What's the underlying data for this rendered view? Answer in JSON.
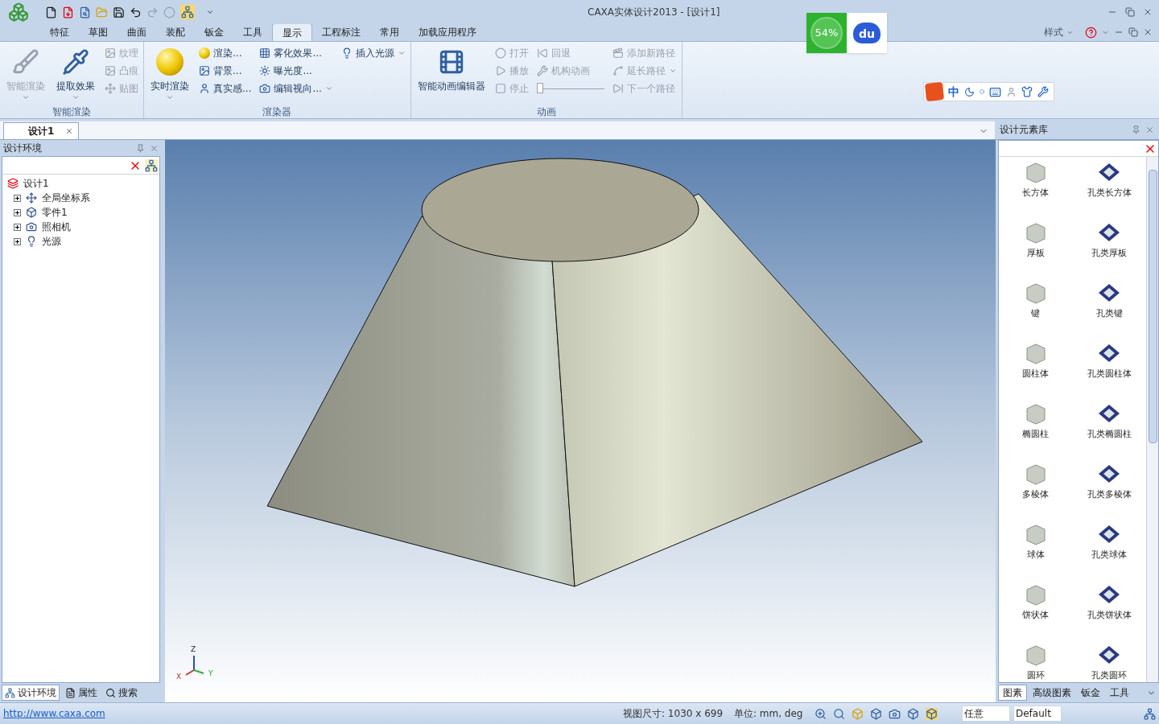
{
  "window": {
    "title": "CAXA实体设计2013 - [设计1]"
  },
  "ribbon_tabs": [
    {
      "label": "特征",
      "selected": false
    },
    {
      "label": "草图",
      "selected": false
    },
    {
      "label": "曲面",
      "selected": false
    },
    {
      "label": "装配",
      "selected": false
    },
    {
      "label": "钣金",
      "selected": false
    },
    {
      "label": "工具",
      "selected": false
    },
    {
      "label": "显示",
      "selected": true
    },
    {
      "label": "工程标注",
      "selected": false
    },
    {
      "label": "常用",
      "selected": false
    },
    {
      "label": "加载应用程序",
      "selected": false
    }
  ],
  "style_menu": "样式",
  "ribbon_groups": [
    {
      "title": "智能渲染",
      "columns": [
        {
          "kind": "large",
          "label": "智能渲染",
          "disabled": true,
          "dropdown": true
        },
        {
          "kind": "large",
          "label": "提取效果",
          "disabled": false,
          "dropdown": true
        },
        {
          "kind": "stack",
          "items": [
            {
              "label": "纹理",
              "disabled": true,
              "dropdown": false
            },
            {
              "label": "凸痕",
              "disabled": true,
              "dropdown": false
            },
            {
              "label": "贴图",
              "disabled": true,
              "dropdown": false
            }
          ]
        }
      ]
    },
    {
      "title": "渲染器",
      "columns": [
        {
          "kind": "large",
          "label": "实时渲染",
          "disabled": false,
          "dropdown": true
        },
        {
          "kind": "stack",
          "items": [
            {
              "label": "渲染...",
              "disabled": false,
              "dropdown": false
            },
            {
              "label": "背景...",
              "disabled": false,
              "dropdown": false
            },
            {
              "label": "真实感...",
              "disabled": false,
              "dropdown": false
            }
          ]
        },
        {
          "kind": "stack",
          "items": [
            {
              "label": "雾化效果...",
              "disabled": false,
              "dropdown": false
            },
            {
              "label": "曝光度...",
              "disabled": false,
              "dropdown": false
            },
            {
              "label": "编辑视向...",
              "disabled": false,
              "dropdown": true
            }
          ]
        },
        {
          "kind": "stack",
          "items": [
            {
              "label": "插入光源",
              "disabled": false,
              "dropdown": true
            }
          ]
        }
      ]
    },
    {
      "title": "动画",
      "columns": [
        {
          "kind": "large",
          "label": "智能动画编辑器",
          "disabled": false,
          "dropdown": false
        },
        {
          "kind": "stack",
          "items": [
            {
              "label": "打开",
              "disabled": true,
              "dropdown": false
            },
            {
              "label": "播放",
              "disabled": true,
              "dropdown": false
            },
            {
              "label": "停止",
              "disabled": true,
              "dropdown": false
            }
          ]
        },
        {
          "kind": "stack",
          "items": [
            {
              "label": "回退",
              "disabled": true,
              "dropdown": false
            },
            {
              "label": "机构动画",
              "disabled": true,
              "dropdown": false
            },
            {
              "kind": "slider",
              "level": 0
            }
          ]
        },
        {
          "kind": "stack",
          "items": [
            {
              "label": "添加新路径",
              "disabled": true,
              "dropdown": false
            },
            {
              "label": "延长路径",
              "disabled": true,
              "dropdown": true
            },
            {
              "label": "下一个路径",
              "disabled": true,
              "dropdown": false
            }
          ]
        }
      ]
    }
  ],
  "speed_widget": {
    "percent": "54%",
    "logo": "du"
  },
  "ime_bar": {
    "mode": "中"
  },
  "document_tabs": [
    {
      "label": "设计1",
      "selected": true
    }
  ],
  "design_panel": {
    "title": "设计环境",
    "tree": [
      {
        "label": "设计1",
        "children": [
          {
            "label": "全局坐标系",
            "expanded": false
          },
          {
            "label": "零件1",
            "expanded": false
          },
          {
            "label": "照相机",
            "expanded": false
          },
          {
            "label": "光源",
            "expanded": false
          }
        ]
      }
    ],
    "tabs": [
      {
        "label": "设计环境",
        "selected": true
      },
      {
        "label": "属性",
        "selected": false
      },
      {
        "label": "搜索",
        "selected": false
      }
    ]
  },
  "viewport": {
    "axes": [
      "Z",
      "X",
      "Y"
    ]
  },
  "library_panel": {
    "title": "设计元素库",
    "items": [
      {
        "label": "长方体",
        "kind": "solid"
      },
      {
        "label": "孔类长方体",
        "kind": "hole"
      },
      {
        "label": "厚板",
        "kind": "solid"
      },
      {
        "label": "孔类厚板",
        "kind": "hole"
      },
      {
        "label": "键",
        "kind": "solid"
      },
      {
        "label": "孔类键",
        "kind": "hole"
      },
      {
        "label": "圆柱体",
        "kind": "solid"
      },
      {
        "label": "孔类圆柱体",
        "kind": "hole"
      },
      {
        "label": "椭圆柱",
        "kind": "solid"
      },
      {
        "label": "孔类椭圆柱",
        "kind": "hole"
      },
      {
        "label": "多棱体",
        "kind": "solid"
      },
      {
        "label": "孔类多棱体",
        "kind": "hole"
      },
      {
        "label": "球体",
        "kind": "solid"
      },
      {
        "label": "孔类球体",
        "kind": "hole"
      },
      {
        "label": "饼状体",
        "kind": "solid"
      },
      {
        "label": "孔类饼状体",
        "kind": "hole"
      },
      {
        "label": "圆环",
        "kind": "solid"
      },
      {
        "label": "孔类圆环",
        "kind": "hole"
      }
    ],
    "tabs": [
      {
        "label": "图素",
        "selected": true
      },
      {
        "label": "高级图素",
        "selected": false
      },
      {
        "label": "钣金",
        "selected": false
      },
      {
        "label": "工具",
        "selected": false
      }
    ]
  },
  "status_bar": {
    "link": "http://www.caxa.com",
    "view_size": "视图尺寸: 1030 x 699",
    "units": "单位: mm, deg",
    "mode": "任意",
    "style": "Default"
  }
}
